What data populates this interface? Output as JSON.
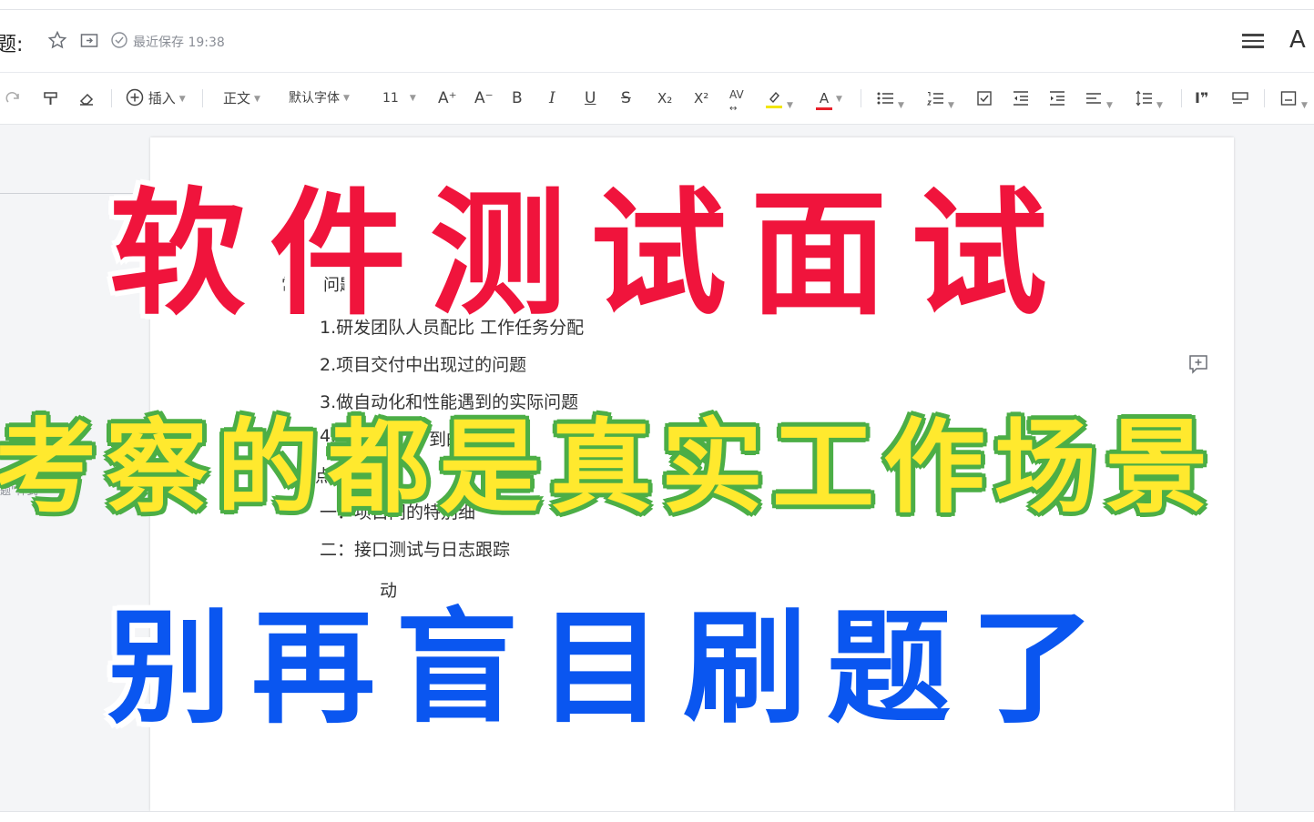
{
  "header": {
    "title_label": "题:",
    "save_status": "最近保存 19:38"
  },
  "toolbar": {
    "insert_label": "插入",
    "style_value": "正文",
    "font_value": "默认字体",
    "size_value": "11",
    "font_increase": "A⁺",
    "font_decrease": "A⁻",
    "bold": "B",
    "italic": "I",
    "underline": "U",
    "strike": "S",
    "subscript": "X₂",
    "superscript": "X²",
    "spacing": "AV",
    "font_color": "A",
    "quote": "I❞"
  },
  "sidebar": {
    "style_hint": "题\"样式"
  },
  "document": {
    "heading_fragment_1": "常",
    "heading_fragment_2": "问题",
    "item1": "1.研发团队人员配比 工作任务分配",
    "item2": "2.项目交付中出现过的问题",
    "item3": "3.做自动化和性能遇到的实际问题",
    "item4a": "4.",
    "item4b": "到的",
    "section_fragment": "的点",
    "sub1": "一：项目问的特别细",
    "sub2": "二：接口测试与日志跟踪",
    "sub3": "动"
  },
  "overlay": {
    "line1": "软件测试面试",
    "line2": "考察的都是真实工作场景",
    "line3": "别再盲目刷题了"
  },
  "colors": {
    "overlay1": "#f0143c",
    "overlay2_fill": "#ffe92e",
    "overlay2_stroke": "#4cae46",
    "overlay3": "#0a56f0",
    "highlight_bar": "#f2e600",
    "font_color_bar": "#e8202a"
  }
}
